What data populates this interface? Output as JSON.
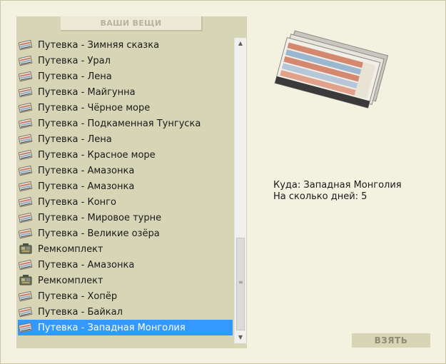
{
  "panel": {
    "title": "ВАШИ ВЕЩИ"
  },
  "items": [
    {
      "label": "Путевка - Зимняя сказка",
      "icon": "ticket-icon"
    },
    {
      "label": "Путевка - Урал",
      "icon": "ticket-icon"
    },
    {
      "label": "Путевка - Лена",
      "icon": "ticket-icon"
    },
    {
      "label": "Путевка - Майгунна",
      "icon": "ticket-icon"
    },
    {
      "label": "Путевка - Чёрное море",
      "icon": "ticket-icon"
    },
    {
      "label": "Путевка - Подкаменная Тунгуска",
      "icon": "ticket-icon"
    },
    {
      "label": "Путевка - Лена",
      "icon": "ticket-icon"
    },
    {
      "label": "Путевка - Красное море",
      "icon": "ticket-icon"
    },
    {
      "label": "Путевка - Амазонка",
      "icon": "ticket-icon"
    },
    {
      "label": "Путевка - Амазонка",
      "icon": "ticket-icon"
    },
    {
      "label": "Путевка - Конго",
      "icon": "ticket-icon"
    },
    {
      "label": "Путевка - Мировое турне",
      "icon": "ticket-icon"
    },
    {
      "label": "Путевка - Великие озёра",
      "icon": "ticket-icon"
    },
    {
      "label": "Ремкомплект",
      "icon": "repair-kit-icon"
    },
    {
      "label": "Путевка - Амазонка",
      "icon": "ticket-icon"
    },
    {
      "label": "Ремкомплект",
      "icon": "repair-kit-icon"
    },
    {
      "label": "Путевка - Хопёр",
      "icon": "ticket-icon"
    },
    {
      "label": "Путевка - Байкал",
      "icon": "ticket-icon"
    },
    {
      "label": "Путевка - Западная Монголия",
      "icon": "ticket-icon",
      "selected": true
    }
  ],
  "details": {
    "destination": "Куда: Западная Монголия",
    "days": "На сколько дней: 5",
    "image_icon": "ticket-bundle-icon"
  },
  "take_button": {
    "label": "ВЗЯТЬ"
  },
  "colors": {
    "background": "#f3f1e0",
    "panel": "#d6d5b6",
    "selection": "#3399ff"
  }
}
